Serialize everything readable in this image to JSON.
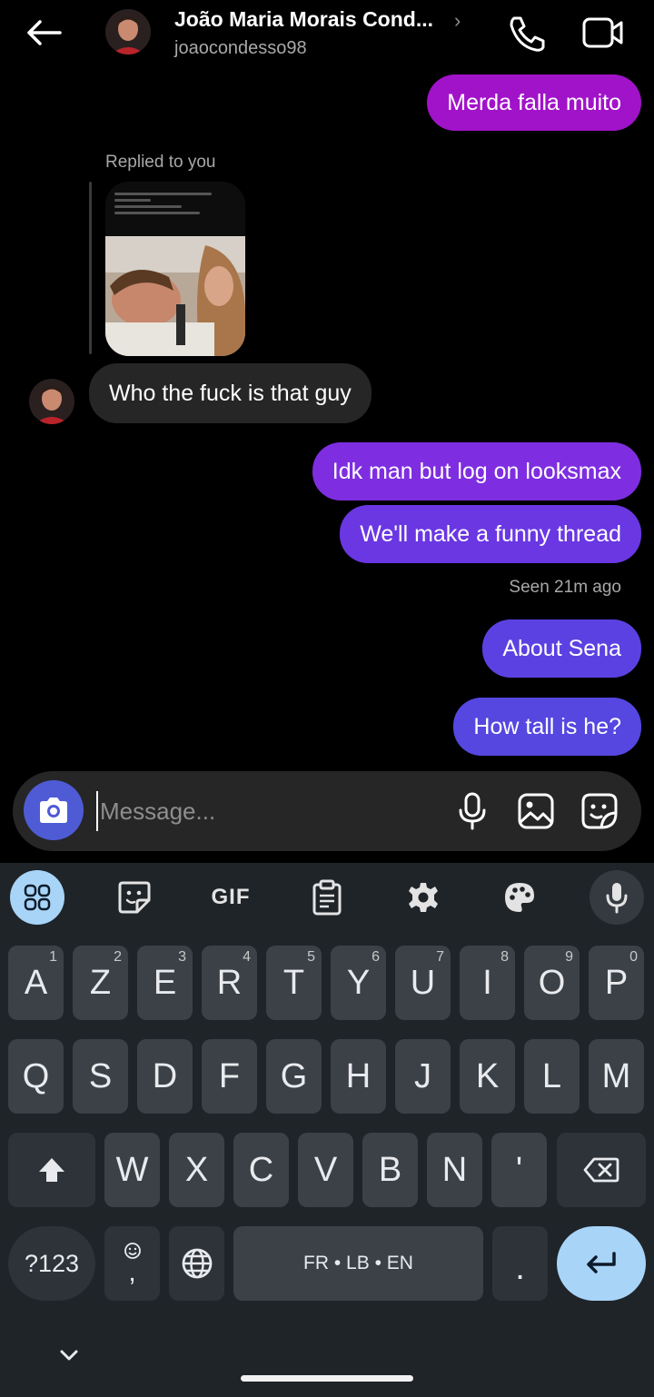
{
  "header": {
    "title": "João Maria Morais Cond...",
    "username": "joaocondesso98",
    "chevron": "›"
  },
  "messages": {
    "m1": "Merda falla muito",
    "replied_label": "Replied to you",
    "m2": "Who the fuck is that guy",
    "m3": "Idk man but log on looksmax",
    "m4": "We'll make a funny thread",
    "seen": "Seen 21m ago",
    "m5": "About Sena",
    "m6": "How tall is he?"
  },
  "composer": {
    "placeholder": "Message..."
  },
  "keyboard": {
    "toolbar": {
      "gif": "GIF"
    },
    "row1": [
      {
        "k": "A",
        "n": "1"
      },
      {
        "k": "Z",
        "n": "2"
      },
      {
        "k": "E",
        "n": "3"
      },
      {
        "k": "R",
        "n": "4"
      },
      {
        "k": "T",
        "n": "5"
      },
      {
        "k": "Y",
        "n": "6"
      },
      {
        "k": "U",
        "n": "7"
      },
      {
        "k": "I",
        "n": "8"
      },
      {
        "k": "O",
        "n": "9"
      },
      {
        "k": "P",
        "n": "0"
      }
    ],
    "row2": [
      "Q",
      "S",
      "D",
      "F",
      "G",
      "H",
      "J",
      "K",
      "L",
      "M"
    ],
    "row3": [
      "W",
      "X",
      "C",
      "V",
      "B",
      "N",
      "'"
    ],
    "symbols": "?123",
    "comma": ",",
    "space": "FR • LB • EN",
    "period": "."
  },
  "colors": {
    "bubble_purple": "#a113c9",
    "bubble_violet_1": "#7e2ee0",
    "bubble_violet_2": "#6a37e3",
    "bubble_blue": "#5547e0",
    "accent_blue": "#4f5bd5"
  }
}
